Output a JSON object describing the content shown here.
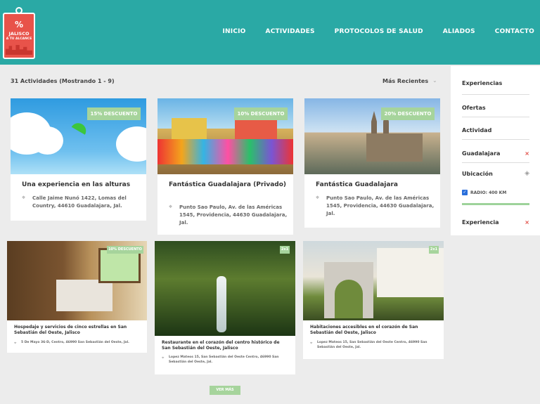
{
  "brand": {
    "percent": "%",
    "line1": "JALISCO",
    "line2": "A TU ALCANCE"
  },
  "nav": [
    "INICIO",
    "ACTIVIDADES",
    "PROTOCOLOS DE SALUD",
    "ALIADOS",
    "CONTACTO"
  ],
  "results": {
    "count_label": "31 Actividades (Mostrando 1 - 9)",
    "sort_label": "Más Recientes"
  },
  "sidebar": {
    "items": [
      "Experiencias",
      "Ofertas",
      "Actividad",
      "Guadalajara",
      "Ubicación",
      "Experiencia"
    ],
    "radius_label": "RADIO: 400 KM"
  },
  "cards": [
    {
      "badge": "15% DESCUENTO",
      "title": "Una experiencia en las alturas",
      "address": "Calle Jaime Nunó 1422, Lomas del Country, 44610 Guadalajara, Jal."
    },
    {
      "badge": "10% DESCUENTO",
      "title": "Fantástica Guadalajara (Privado)",
      "address": "Punto Sao Paulo, Av. de las Américas 1545, Providencia, 44630 Guadalajara, Jal."
    },
    {
      "badge": "20% DESCUENTO",
      "title": "Fantástica Guadalajara",
      "address": "Punto Sao Paulo, Av. de las Américas 1545, Providencia, 44630 Guadalajara, Jal."
    },
    {
      "badge": "10% DESCUENTO",
      "title": "Hospedaje y servicios de cinco estrellas en San Sebastián del Oeste, Jalisco",
      "address": "5 De Mayo 36-D, Centro, 46990 San Sebastián del Oeste, Jal."
    },
    {
      "badge": "2x1",
      "title": "Restaurante en el corazón del centro histórico de San Sebastián del Oeste, Jalisco",
      "address": "Lopez Mateos 15, San Sebastián del Oeste Centro, 46990 San Sebastián del Oeste, Jal."
    },
    {
      "badge": "2x1",
      "title": "Habitaciones accesibles en el corazón de San Sebastián del Oeste, Jalisco",
      "address": "Lopez Mateos 15, San Sebastián del Oeste Centro, 46990 San Sebastián del Oeste, Jal."
    }
  ],
  "load_more": "VER MÁS"
}
